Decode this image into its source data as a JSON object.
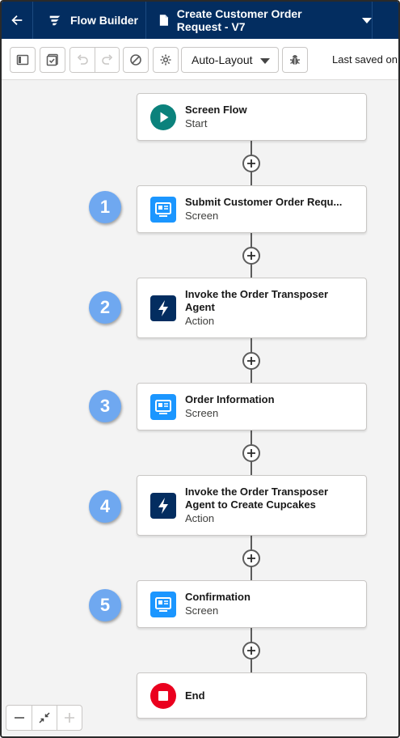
{
  "header": {
    "app_title": "Flow Builder",
    "flow_title": "Create Customer Order Request - V7"
  },
  "toolbar": {
    "layout_value": "Auto-Layout",
    "last_saved": "Last saved on"
  },
  "nodes": [
    {
      "title": "Screen Flow",
      "subtitle": "Start",
      "icon": "play-icon"
    },
    {
      "title": "Submit Customer Order Requ...",
      "subtitle": "Screen",
      "icon": "screen-icon",
      "step": "1"
    },
    {
      "title": "Invoke the Order Transposer Agent",
      "subtitle": "Action",
      "icon": "lightning-icon",
      "step": "2"
    },
    {
      "title": "Order Information",
      "subtitle": "Screen",
      "icon": "screen-icon",
      "step": "3"
    },
    {
      "title": "Invoke the Order Transposer Agent to Create Cupcakes",
      "subtitle": "Action",
      "icon": "lightning-icon",
      "step": "4"
    },
    {
      "title": "Confirmation",
      "subtitle": "Screen",
      "icon": "screen-icon",
      "step": "5"
    },
    {
      "title": "End",
      "subtitle": "",
      "icon": "stop-icon"
    }
  ],
  "colors": {
    "header_bg": "#032d60",
    "start_icon": "#0b827c",
    "screen_icon": "#1b96ff",
    "action_icon": "#032d60",
    "end_icon": "#ea001e",
    "step_badge": "#6fa8f0"
  }
}
